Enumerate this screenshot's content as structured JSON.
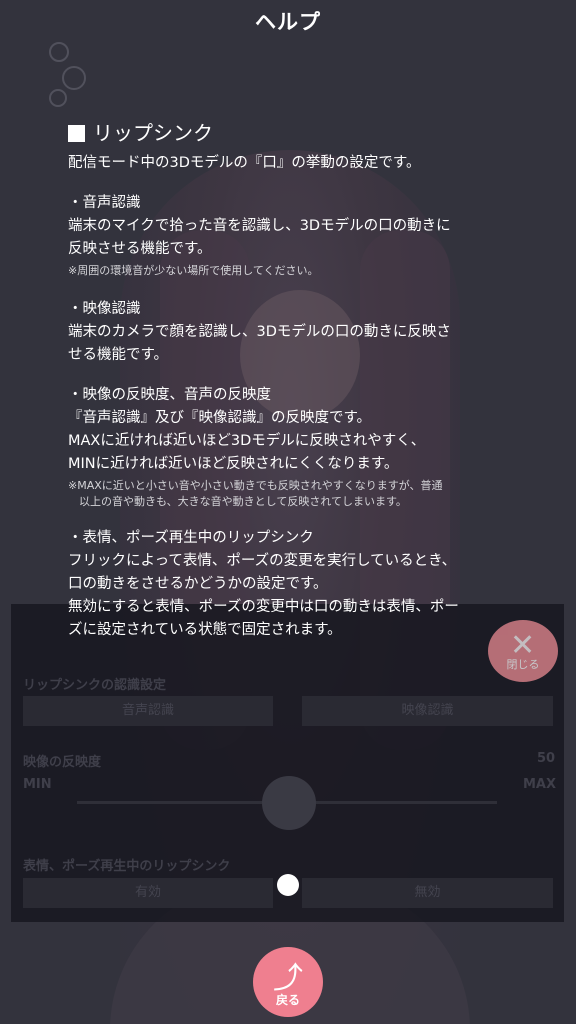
{
  "header": {
    "title": "ヘルプ"
  },
  "help": {
    "heading": "リップシンク",
    "intro": "配信モード中の3Dモデルの『口』の挙動の設定です。",
    "sections": [
      {
        "title": "・音声認識",
        "lines": [
          "端末のマイクで拾った音を認識し、3Dモデルの口の動きに",
          "反映させる機能です。"
        ],
        "note": [
          "※周囲の環境音が少ない場所で使用してください。"
        ]
      },
      {
        "title": "・映像認識",
        "lines": [
          "端末のカメラで顔を認識し、3Dモデルの口の動きに反映さ",
          "せる機能です。"
        ]
      },
      {
        "title": "・映像の反映度、音声の反映度",
        "lines": [
          "『音声認識』及び『映像認識』の反映度です。",
          "MAXに近ければ近いほど3Dモデルに反映されやすく、",
          "MINに近ければ近いほど反映されにくくなります。"
        ],
        "note": [
          "※MAXに近いと小さい音や小さい動きでも反映されやすくなりますが、普通",
          "　以上の音や動きも、大きな音や動きとして反映されてしまいます。"
        ]
      },
      {
        "title": "・表情、ポーズ再生中のリップシンク",
        "lines": [
          "フリックによって表情、ポーズの変更を実行しているとき、",
          "口の動きをさせるかどうかの設定です。",
          "無効にすると表情、ポーズの変更中は口の動きは表情、ポー",
          "ズに設定されている状態で固定されます。"
        ]
      }
    ]
  },
  "settings": {
    "close_label": "閉じる",
    "lipsync_label": "リップシンクの認識設定",
    "audio_btn": "音声認識",
    "video_btn": "映像認識",
    "video_level_label": "映像の反映度",
    "video_level_value": "50",
    "min_label": "MIN",
    "max_label": "MAX",
    "expression_label": "表情、ポーズ再生中のリップシンク",
    "enabled_btn": "有効",
    "disabled_btn": "無効"
  },
  "back": {
    "label": "戻る"
  }
}
